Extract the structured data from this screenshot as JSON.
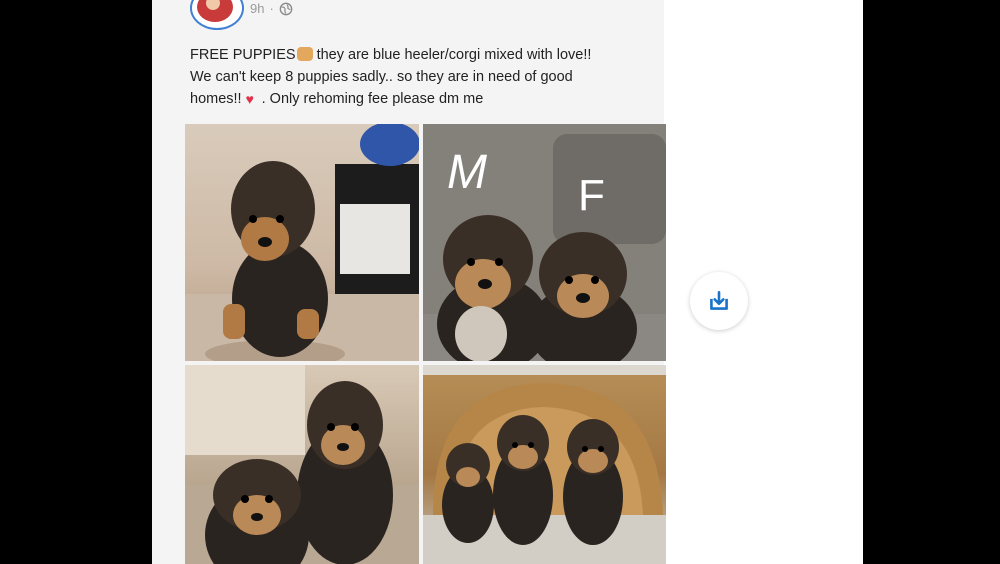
{
  "post": {
    "time": "9h",
    "text_line1_a": "FREE PUPPIES",
    "text_line1_b": " they are blue heeler/corgi mixed with love!!",
    "text_line2": "We can't keep 8 puppies sadly.. so they are in need of good",
    "text_line3_a": "homes!!",
    "text_line3_b": ". Only rehoming fee please dm me"
  },
  "photos": {
    "label_m": "M",
    "label_f": "F"
  },
  "icons": {
    "privacy": "globe-icon",
    "share": "download-share-icon"
  },
  "colors": {
    "accent": "#3f7fd6",
    "share_icon": "#1a73c8"
  }
}
